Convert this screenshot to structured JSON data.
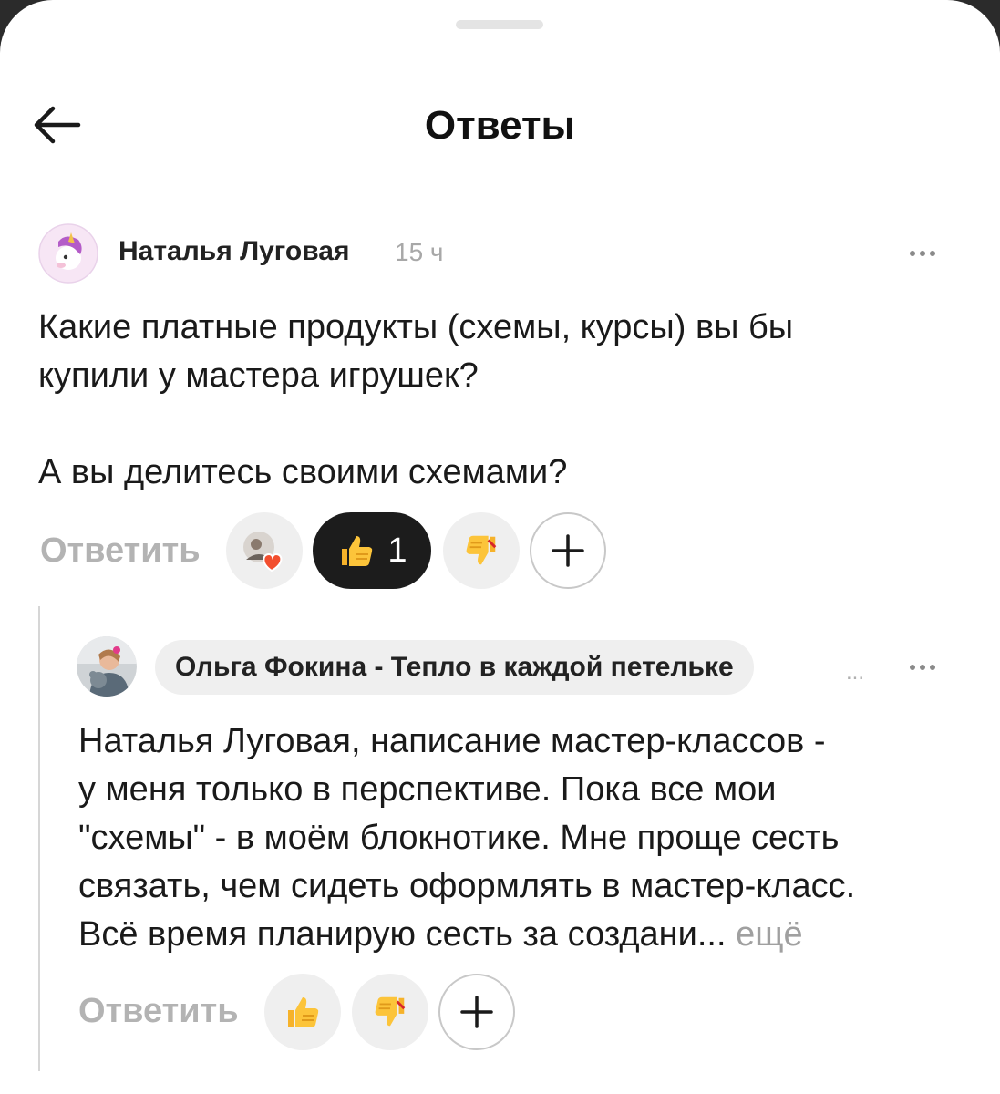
{
  "header": {
    "title": "Ответы",
    "back_icon": "arrow-left-icon"
  },
  "post": {
    "author": "Наталья Луговая",
    "time": "15 ч",
    "avatar_icon": "unicorn-avatar",
    "text_line1": "Какие платные продукты (схемы, курсы) вы бы",
    "text_line2": "купили у мастера игрушек?",
    "text_line3": "А вы делитесь своими схемами?",
    "reply_label": "Ответить",
    "reactions": {
      "reactors_icon": "reactor-avatar-heart",
      "like_icon": "thumbs-up-icon",
      "like_count": "1",
      "dislike_icon": "thumbs-down-icon",
      "add_icon": "plus-icon"
    },
    "colors": {
      "like_active_bg": "#1c1c1c",
      "pill_bg": "#efefef"
    }
  },
  "reply": {
    "author": "Ольга Фокина - Тепло в каждой петельке",
    "ellipsis": "...",
    "avatar_icon": "photo-avatar",
    "text_line1": "Наталья Луговая, написание мастер-классов -",
    "text_line2": "у меня только в перспективе. Пока все мои",
    "text_line3": "\"схемы\" - в моём блокнотике. Мне проще сесть",
    "text_line4": "связать, чем сидеть оформлять в мастер-класс.",
    "text_line5": "Всё время планирую сесть за создани...",
    "more_label": "ещё",
    "reply_label": "Ответить",
    "reactions": {
      "like_icon": "thumbs-up-icon",
      "dislike_icon": "thumbs-down-icon",
      "add_icon": "plus-icon"
    }
  }
}
